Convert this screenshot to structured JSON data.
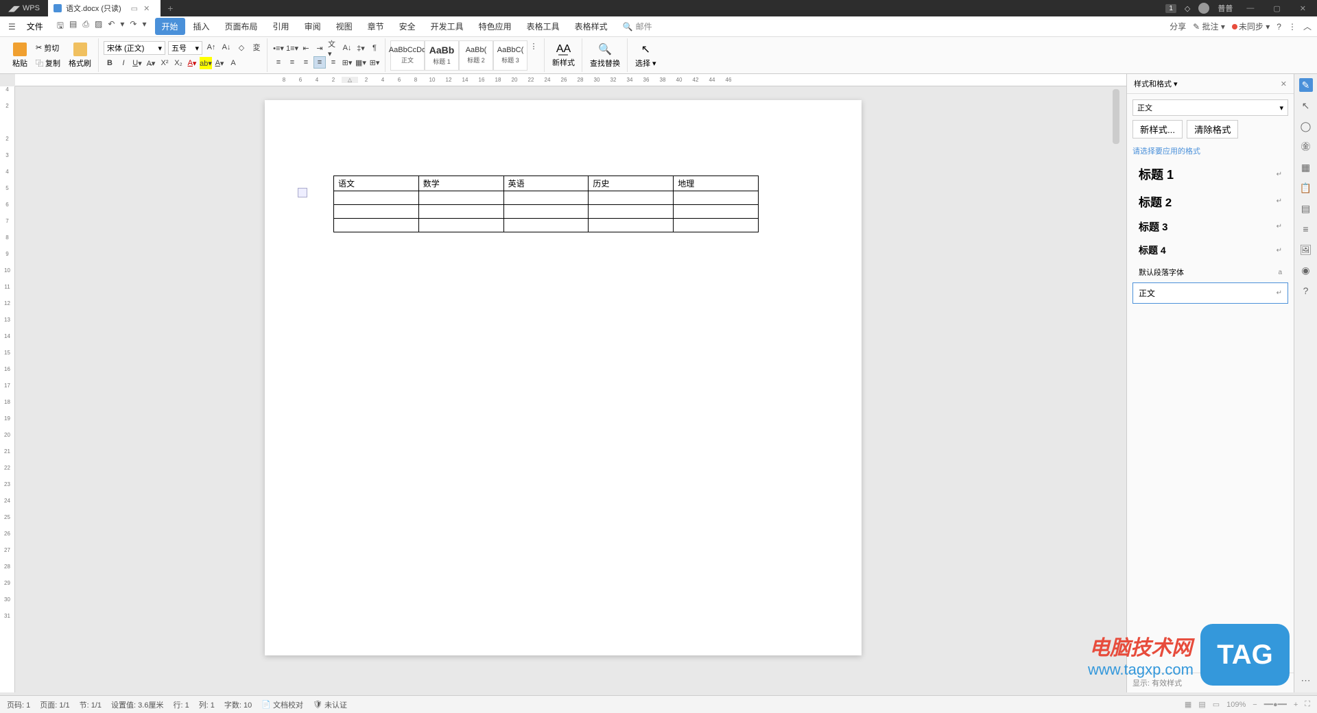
{
  "title_bar": {
    "app": "WPS",
    "doc_title": "语文.docx (只读)",
    "badge": "1",
    "username": "普普"
  },
  "menu": {
    "file": "文件",
    "tabs": [
      "开始",
      "插入",
      "页面布局",
      "引用",
      "审阅",
      "视图",
      "章节",
      "安全",
      "开发工具",
      "特色应用",
      "表格工具",
      "表格样式"
    ],
    "active_tab": 0,
    "search_placeholder": "邮件",
    "share": "分享",
    "comment": "批注",
    "sync": "未同步"
  },
  "ribbon": {
    "paste": "粘贴",
    "cut": "剪切",
    "copy": "复制",
    "format_painter": "格式刷",
    "font_name": "宋体 (正文)",
    "font_size": "五号",
    "styles": [
      {
        "preview": "AaBbCcDd",
        "label": "正文"
      },
      {
        "preview": "AaBb",
        "label": "标题 1"
      },
      {
        "preview": "AaBb(",
        "label": "标题 2"
      },
      {
        "preview": "AaBbC(",
        "label": "标题 3"
      }
    ],
    "new_style": "新样式",
    "find_replace": "查找替换",
    "select": "选择"
  },
  "document": {
    "table_headers": [
      "语文",
      "数学",
      "英语",
      "历史",
      "地理"
    ],
    "table_rows": 4
  },
  "right_panel": {
    "title": "样式和格式",
    "current": "正文",
    "new_style_btn": "新样式...",
    "clear_fmt_btn": "清除格式",
    "prompt": "请选择要应用的格式",
    "styles": [
      {
        "name": "标题 1",
        "cls": "h1"
      },
      {
        "name": "标题 2",
        "cls": "h2"
      },
      {
        "name": "标题 3",
        "cls": "h3"
      },
      {
        "name": "标题 4",
        "cls": "h4"
      },
      {
        "name": "默认段落字体",
        "cls": "def"
      },
      {
        "name": "正文",
        "cls": "body",
        "selected": true
      }
    ],
    "show_label": "显示: 有效样式"
  },
  "status": {
    "page_code": "页码: 1",
    "page": "页面: 1/1",
    "section": "节: 1/1",
    "pos": "设置值: 3.6厘米",
    "line": "行: 1",
    "col": "列: 1",
    "words": "字数: 10",
    "proof": "文档校对",
    "auth": "未认证",
    "zoom": "109%"
  },
  "watermark": {
    "title": "电脑技术网",
    "url": "www.tagxp.com",
    "tag": "TAG"
  }
}
